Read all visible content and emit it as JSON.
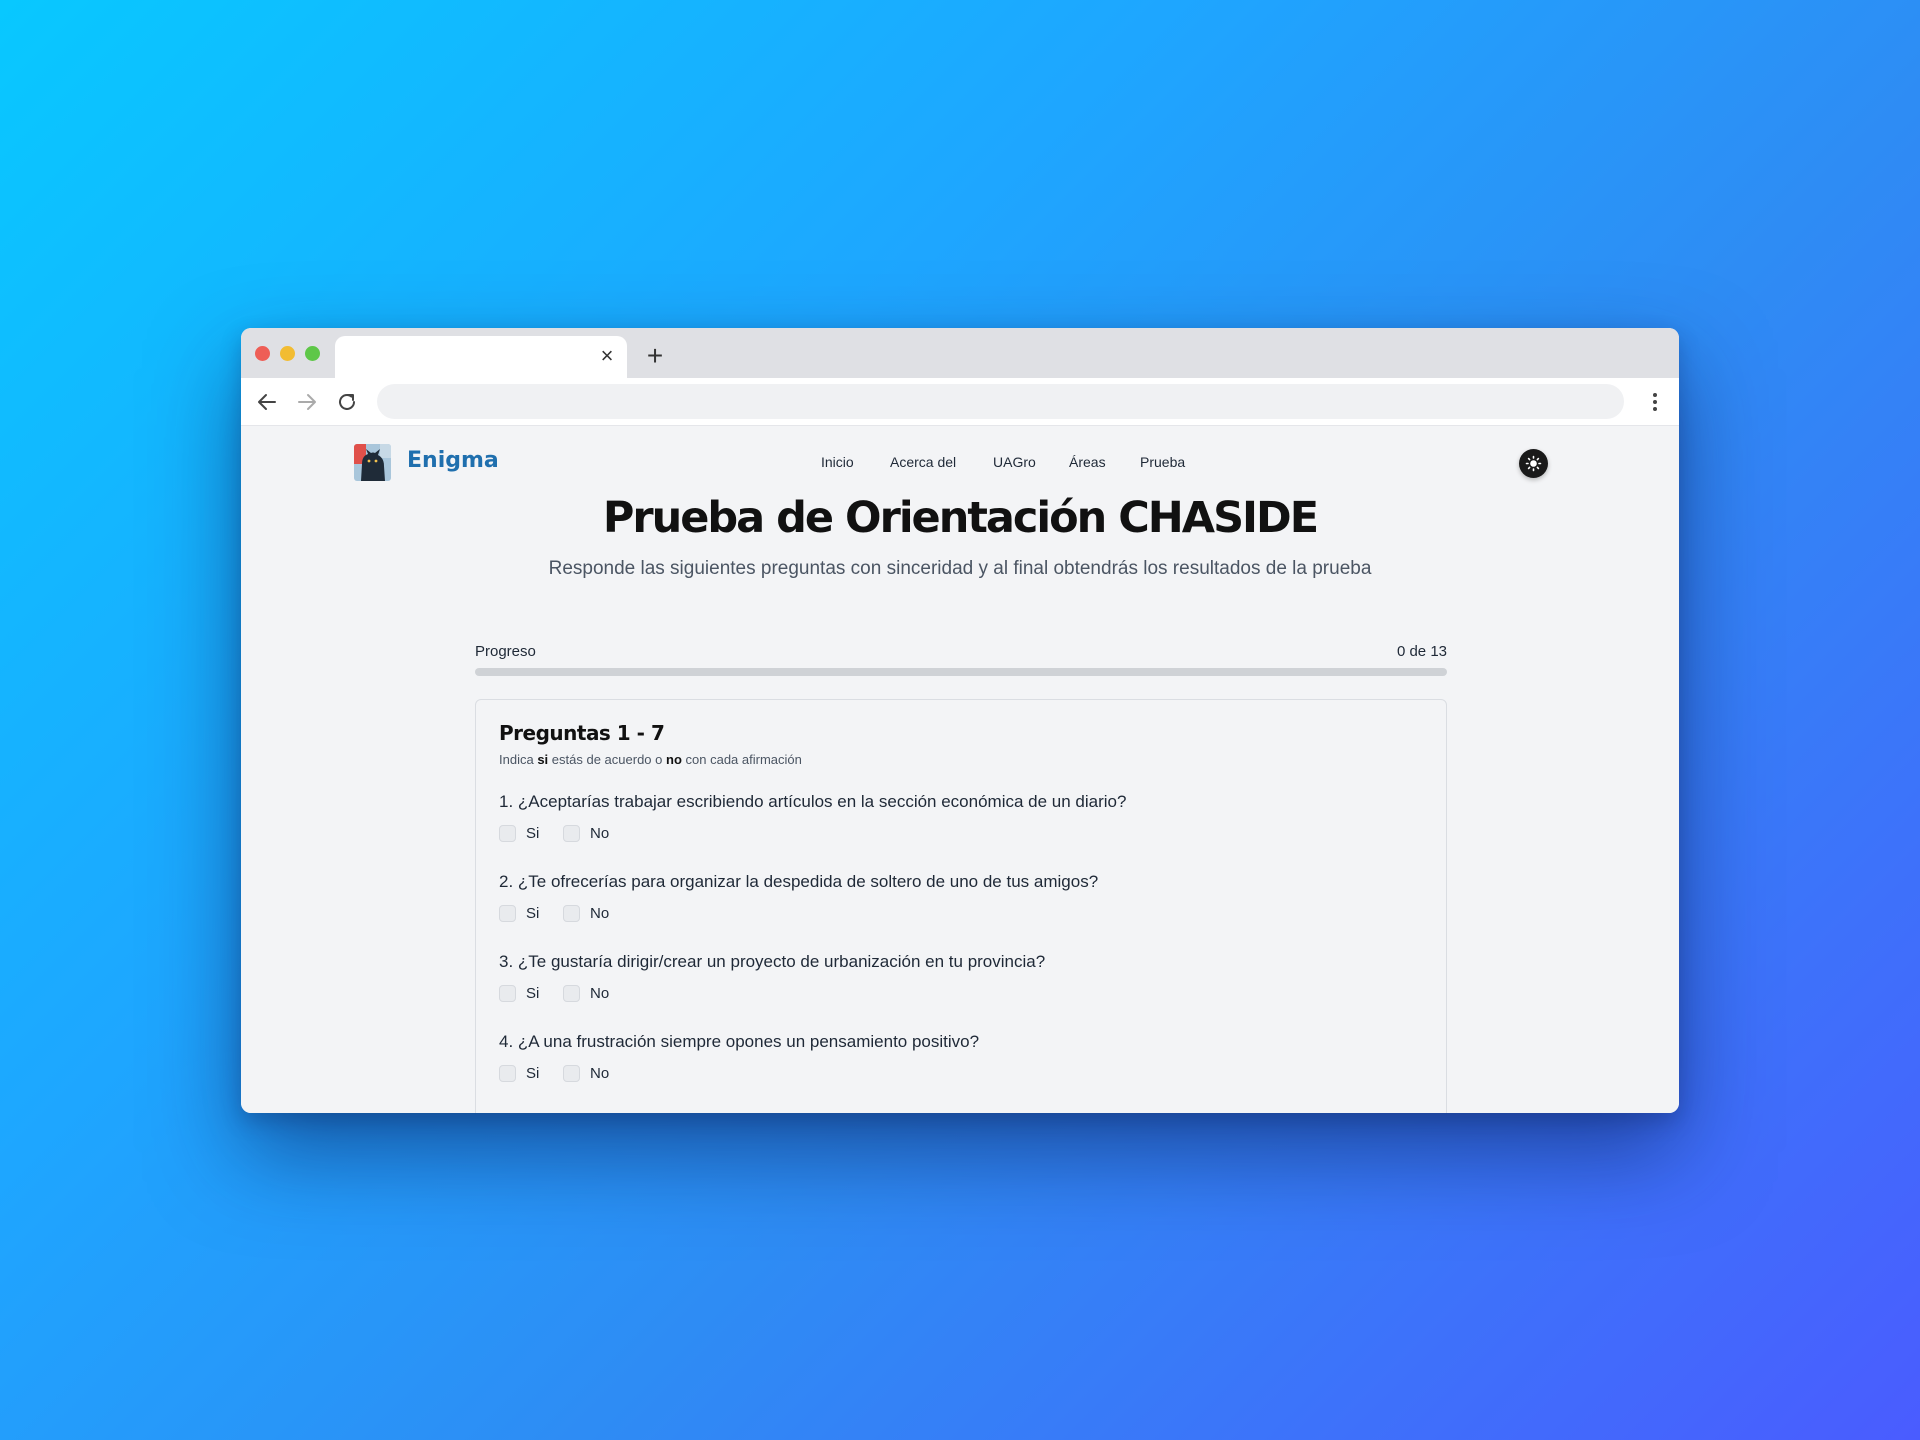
{
  "browser": {
    "tab_title": "",
    "close_icon": "close-icon",
    "new_tab_icon": "plus-icon",
    "address_value": "",
    "address_placeholder": ""
  },
  "site": {
    "brand": "Enigma",
    "logo_icon": "panther-logo",
    "nav": [
      "Inicio",
      "Acerca del",
      "UAGro",
      "Áreas",
      "Prueba"
    ],
    "theme_toggle_icon": "sun-icon",
    "accent_color": "#1f6fae"
  },
  "page": {
    "title": "Prueba de Orientación CHASIDE",
    "subtitle": "Responde las siguientes preguntas con sinceridad y al final obtendrás los resultados de la prueba"
  },
  "progress": {
    "label": "Progreso",
    "count_text": "0 de 13",
    "current": 0,
    "total": 13
  },
  "section": {
    "title": "Preguntas 1 - 7",
    "hint_prefix": "Indica",
    "hint_yes": "si",
    "hint_middle": "estás de acuerdo o",
    "hint_no": "no",
    "hint_suffix": "con cada afirmación",
    "questions": [
      {
        "text": "1. ¿Aceptarías trabajar escribiendo artículos en la sección económica de un diario?",
        "yes": "Si",
        "no": "No"
      },
      {
        "text": "2. ¿Te ofrecerías para organizar la despedida de soltero de uno de tus amigos?",
        "yes": "Si",
        "no": "No"
      },
      {
        "text": "3. ¿Te gustaría dirigir/crear un proyecto de urbanización en tu provincia?",
        "yes": "Si",
        "no": "No"
      },
      {
        "text": "4. ¿A una frustración siempre opones un pensamiento positivo?",
        "yes": "Si",
        "no": "No"
      }
    ]
  }
}
